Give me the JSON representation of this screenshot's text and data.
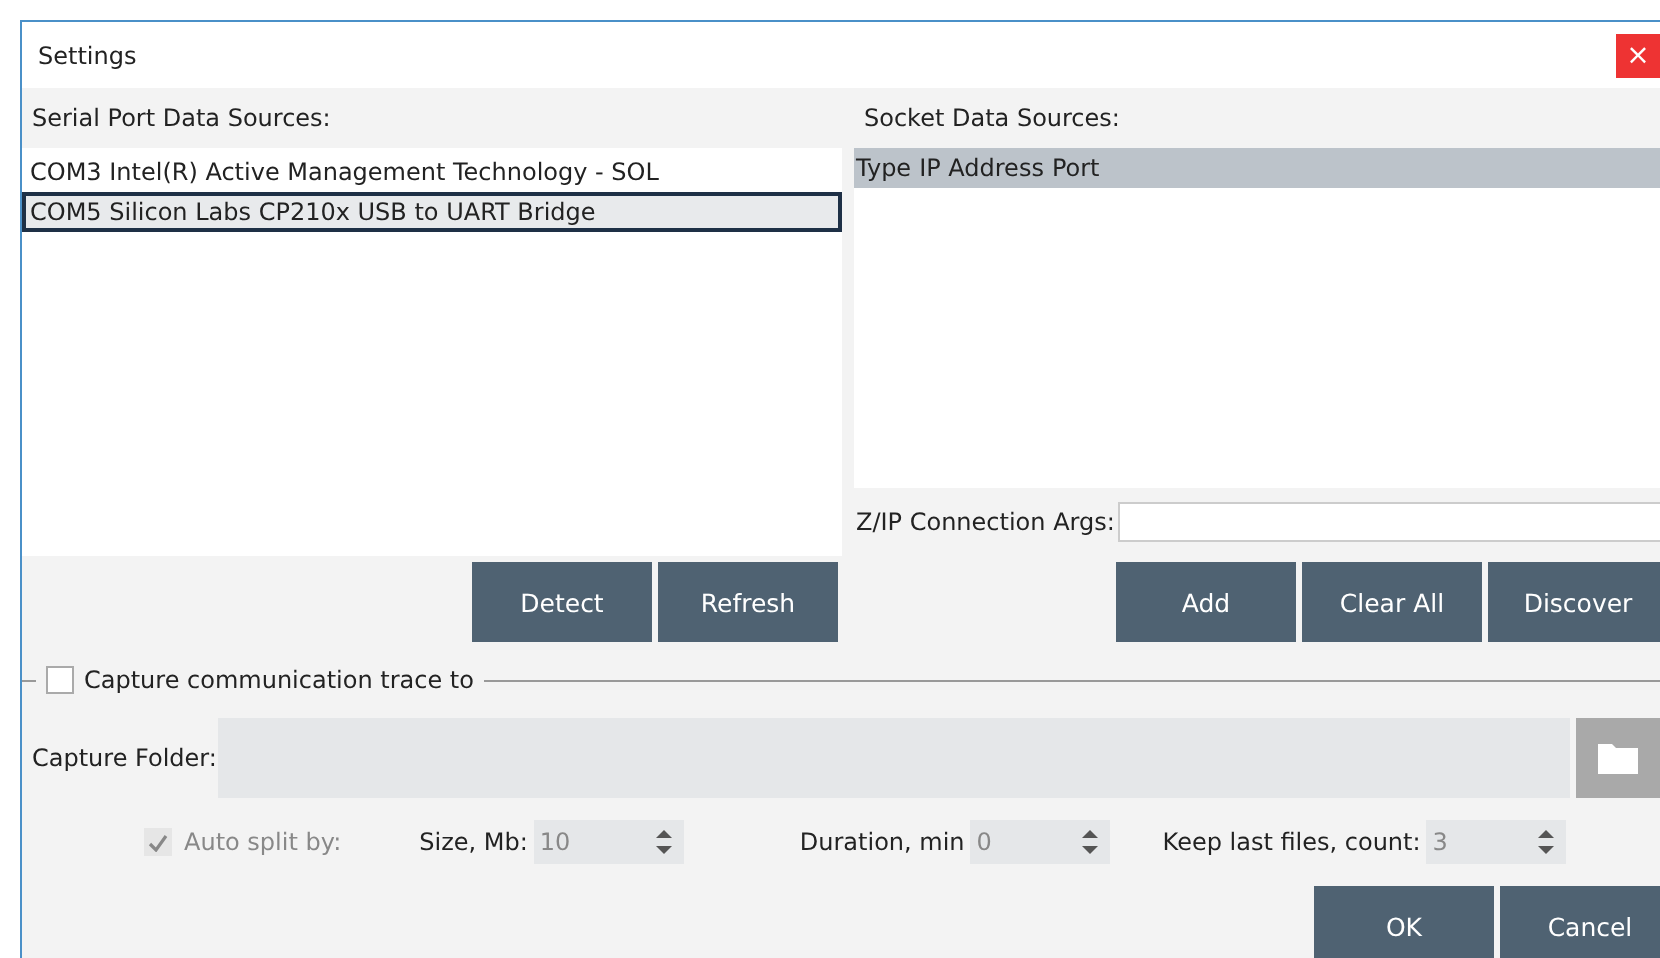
{
  "window": {
    "title": "Settings",
    "close": "×"
  },
  "serial": {
    "label": "Serial Port Data Sources:",
    "items": [
      {
        "port": "COM3",
        "name": "Intel(R) Active Management Technology - SOL",
        "selected": false
      },
      {
        "port": "COM5",
        "name": "Silicon Labs CP210x USB to UART Bridge",
        "selected": true
      }
    ],
    "buttons": [
      "Detect",
      "Refresh"
    ]
  },
  "socket": {
    "label": "Socket Data Sources:",
    "columns": [
      "Type",
      "IP Address",
      "Port"
    ],
    "args_label": "Z/IP Connection Args:",
    "buttons": [
      "Add",
      "Clear All",
      "Discover"
    ]
  },
  "capture": {
    "label": "Capture communication trace to",
    "checked": false,
    "folder_label": "Capture Folder:",
    "auto_split": {
      "label": "Auto split by:",
      "checked": true,
      "disabled": true
    },
    "spinners": [
      {
        "label": "Size, Mb:",
        "value": "10"
      },
      {
        "label": "Duration, min",
        "value": "0"
      },
      {
        "label": "Keep last files, count:",
        "value": "3"
      }
    ]
  },
  "buttons": [
    "OK",
    "Cancel"
  ]
}
